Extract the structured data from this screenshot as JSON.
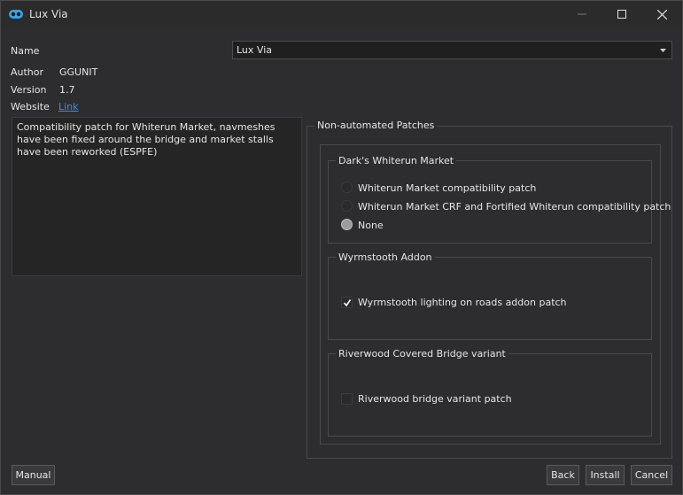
{
  "window": {
    "title": "Lux Via",
    "controls": {
      "minimize_icon": "minimize-icon",
      "maximize_icon": "maximize-icon",
      "close_icon": "close-icon"
    }
  },
  "info": {
    "name_label": "Name",
    "name_value": "Lux Via",
    "author_label": "Author",
    "author_value": "GGUNIT",
    "version_label": "Version",
    "version_value": "1.7",
    "website_label": "Website",
    "website_link": "Link",
    "description": "Compatibility patch for Whiterun Market, navmeshes have been fixed around the bridge and market stalls have been reworked (ESPFE)"
  },
  "patches": {
    "title": "Non-automated Patches",
    "groups": [
      {
        "title": "Dark's Whiterun Market",
        "type": "radio",
        "options": [
          {
            "label": "Whiterun Market compatibility patch",
            "selected": false
          },
          {
            "label": "Whiterun Market CRF and Fortified Whiterun compatibility patch",
            "selected": false
          },
          {
            "label": "None",
            "selected": true
          }
        ]
      },
      {
        "title": "Wyrmstooth Addon",
        "type": "checkbox",
        "options": [
          {
            "label": "Wyrmstooth lighting on roads addon patch",
            "checked": true
          }
        ]
      },
      {
        "title": "Riverwood Covered Bridge variant",
        "type": "checkbox",
        "options": [
          {
            "label": "Riverwood bridge variant patch",
            "checked": false
          }
        ]
      }
    ]
  },
  "buttons": {
    "manual": "Manual",
    "back": "Back",
    "install": "Install",
    "cancel": "Cancel"
  },
  "colors": {
    "background": "#2d2d30",
    "link": "#3d8ee6",
    "app_icon": "#3aa0e8"
  }
}
